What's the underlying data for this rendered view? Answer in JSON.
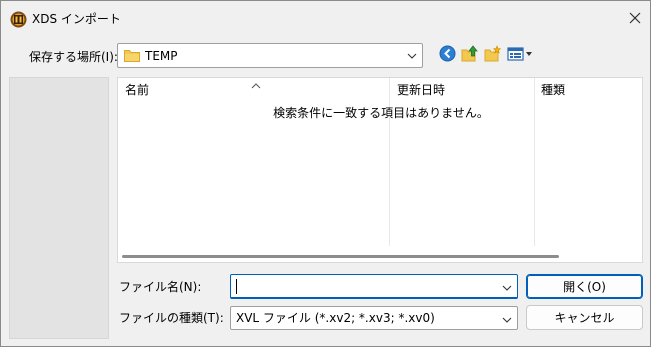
{
  "window": {
    "title": "XDS インポート",
    "icons": {
      "app": "xds-app-icon",
      "close": "close-icon"
    }
  },
  "lookin": {
    "label": "保存する場所(I):",
    "value": "TEMP",
    "toolbar": [
      "back-icon",
      "up-folder-icon",
      "new-folder-icon",
      "view-menu-icon"
    ]
  },
  "filelist": {
    "columns": [
      "名前",
      "更新日時",
      "種類"
    ],
    "empty_message": "検索条件に一致する項目はありません。"
  },
  "filename": {
    "label": "ファイル名(N):",
    "value": "",
    "placeholder": ""
  },
  "filetype": {
    "label": "ファイルの種類(T):",
    "value": "XVL ファイル (*.xv2; *.xv3; *.xv0)"
  },
  "buttons": {
    "open": "開く(O)",
    "cancel": "キャンセル"
  },
  "colors": {
    "accent": "#005fb8",
    "window_bg": "#f0f0f0",
    "places_bg": "#e3e3e3",
    "folder": "#f2c94c"
  }
}
